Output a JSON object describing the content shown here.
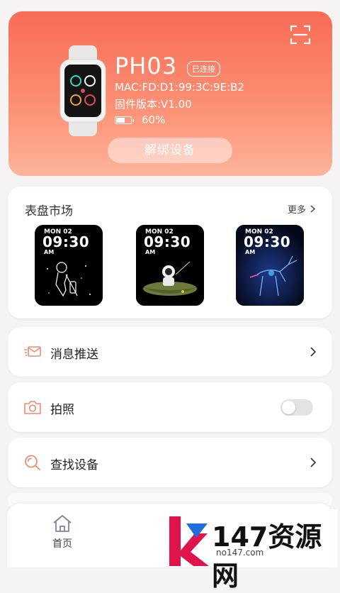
{
  "device": {
    "name": "PH03",
    "status_badge": "已连接",
    "mac": "MAC:FD:D1:99:3C:9E:B2",
    "firmware": "固件版本:V1.00",
    "battery_level": 0.6,
    "battery": "60%",
    "unbind_label": "解绑设备",
    "icons": {
      "scan": "scan-icon",
      "watch": "smartwatch-image",
      "battery": "battery-icon"
    }
  },
  "market": {
    "title": "表盘市场",
    "more_label": "更多",
    "faces": [
      {
        "date": "MON 02",
        "time": "09:30",
        "ampm": "AM",
        "theme": "astronaut-sketch"
      },
      {
        "date": "MON 02",
        "time": "09:30",
        "ampm": "AM",
        "theme": "astronaut-boat"
      },
      {
        "date": "MON 02",
        "time": "09:30",
        "ampm": "AM",
        "theme": "neon-deer"
      }
    ]
  },
  "menu": {
    "items": [
      {
        "label": "消息推送",
        "icon": "message-icon",
        "control": "chevron"
      },
      {
        "label": "拍照",
        "icon": "camera-icon",
        "control": "toggle",
        "toggle_on": false
      },
      {
        "label": "查找设备",
        "icon": "search-icon",
        "control": "chevron"
      }
    ]
  },
  "tabbar": {
    "tabs": [
      {
        "label": "首页",
        "icon": "home-icon"
      }
    ]
  },
  "watermark": {
    "text": "147资源网",
    "sub": "no147.com"
  },
  "colors": {
    "accent": "#f96b55",
    "accent_light": "#fdb49c",
    "icon_orange": "#ee8a70",
    "text": "#222222"
  }
}
